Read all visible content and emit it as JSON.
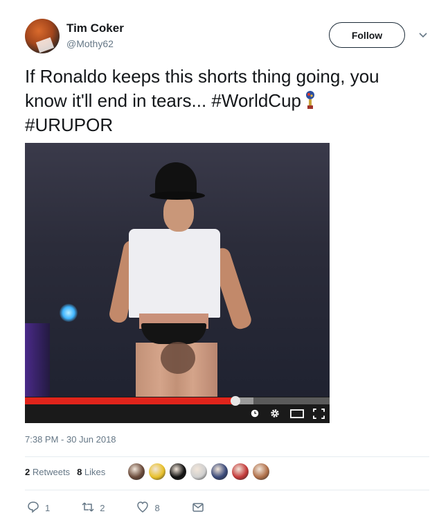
{
  "tweet": {
    "author_name": "Tim Coker",
    "author_handle": "@Mothy62",
    "follow_label": "Follow",
    "text_line1": "If Ronaldo keeps this shorts thing going, you",
    "text_line2": "know it'll end in tears... ",
    "hashtag1": "#WorldCup",
    "hashtag2": "#URUPOR",
    "timestamp": "7:38 PM - 30 Jun 2018"
  },
  "video": {
    "progress_fraction": 0.69,
    "buffer_fraction": 0.75,
    "icons": [
      "clock-icon",
      "gear-icon",
      "theater-mode-icon",
      "fullscreen-icon"
    ]
  },
  "stats": {
    "retweets_count": "2",
    "retweets_label": "Retweets",
    "likes_count": "8",
    "likes_label": "Likes",
    "liker_avatar_colors": [
      "#6a4a3a",
      "#e8c02a",
      "#111111",
      "#cfcfcf",
      "#3a4a7a",
      "#c43a3a",
      "#b0704a"
    ]
  },
  "actions": {
    "reply_count": "1",
    "retweet_count": "2",
    "like_count": "8"
  },
  "colors": {
    "text": "#14171a",
    "muted": "#657786",
    "progress": "#e0241b"
  }
}
